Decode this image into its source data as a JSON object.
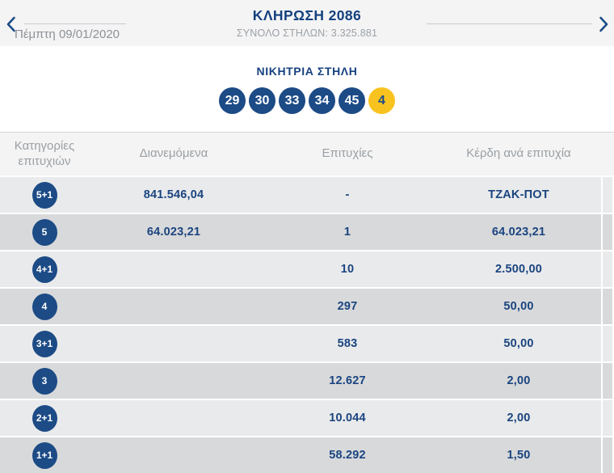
{
  "header": {
    "title": "ΚΛΗΡΩΣΗ 2086",
    "total_columns": "ΣΥΝΟΛΟ ΣΤΗΛΩΝ: 3.325.881",
    "date": "Πέμπτη 09/01/2020",
    "prev_icon": "chevron-left",
    "next_icon": "chevron-right"
  },
  "winning": {
    "title": "ΝΙΚΗΤΡΙΑ ΣΤΗΛΗ",
    "numbers": [
      "29",
      "30",
      "33",
      "34",
      "45"
    ],
    "joker": "4"
  },
  "table": {
    "headers": [
      "Κατηγορίες επιτυχιών",
      "Διανεμόμενα",
      "Επιτυχίες",
      "Κέρδη ανά επιτυχία"
    ],
    "rows": [
      {
        "category": "5+1",
        "distributed": "841.546,04",
        "winners": "-",
        "prize": "ΤΖΑΚ-ΠΟΤ"
      },
      {
        "category": "5",
        "distributed": "64.023,21",
        "winners": "1",
        "prize": "64.023,21"
      },
      {
        "category": "4+1",
        "distributed": "",
        "winners": "10",
        "prize": "2.500,00"
      },
      {
        "category": "4",
        "distributed": "",
        "winners": "297",
        "prize": "50,00"
      },
      {
        "category": "3+1",
        "distributed": "",
        "winners": "583",
        "prize": "50,00"
      },
      {
        "category": "3",
        "distributed": "",
        "winners": "12.627",
        "prize": "2,00"
      },
      {
        "category": "2+1",
        "distributed": "",
        "winners": "10.044",
        "prize": "2,00"
      },
      {
        "category": "1+1",
        "distributed": "",
        "winners": "58.292",
        "prize": "1,50"
      }
    ]
  },
  "colors": {
    "navy_text": "#1a4480",
    "ball_blue": "#1c4b86",
    "joker_yellow": "#f9c31f",
    "band_bg": "#f4f4f5",
    "row_light": "#e9eaeb",
    "row_dark": "#d8d9da",
    "muted_gray": "#9aa0a4"
  }
}
